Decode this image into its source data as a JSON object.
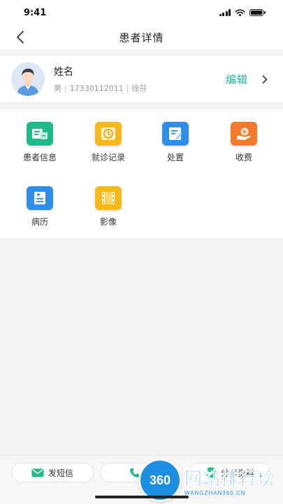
{
  "status_bar": {
    "time": "9:41"
  },
  "nav": {
    "title": "患者详情"
  },
  "profile": {
    "name": "姓名",
    "gender": "男",
    "phone": "17330112011",
    "doctor": "徐芬",
    "separator": "|",
    "edit_label": "编辑"
  },
  "grid": [
    {
      "label": "患者信息",
      "icon": "patient-info-icon",
      "color": "#1fb98a"
    },
    {
      "label": "就诊记录",
      "icon": "visit-record-icon",
      "color": "#f6b81c"
    },
    {
      "label": "处置",
      "icon": "treatment-icon",
      "color": "#2e8fe8"
    },
    {
      "label": "收费",
      "icon": "charge-icon",
      "color": "#f27a2b"
    },
    {
      "label": "病历",
      "icon": "medical-record-icon",
      "color": "#2f8fe6"
    },
    {
      "label": "影像",
      "icon": "imaging-icon",
      "color": "#f5b91c"
    }
  ],
  "bottom": {
    "sms_label": "发短信",
    "call_label": "打",
    "share_label": "分享资料"
  },
  "watermark": {
    "badge": "360",
    "title": "网站排行榜",
    "sub": "WANGZHAN360.CN"
  },
  "colors": {
    "accent": "#23b49b",
    "background": "#f2f3f5"
  }
}
